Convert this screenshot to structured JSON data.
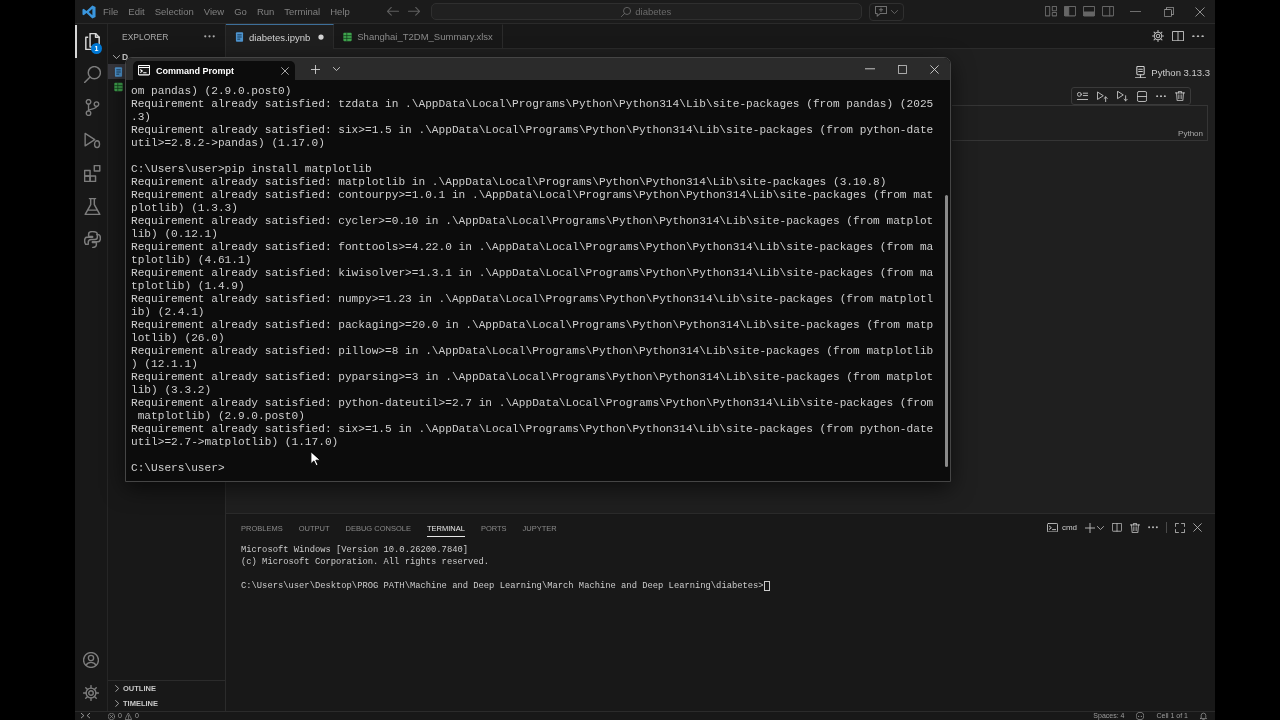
{
  "title_bar": {
    "menu": [
      "File",
      "Edit",
      "Selection",
      "View",
      "Go",
      "Run",
      "Terminal",
      "Help"
    ],
    "command_center": {
      "value": "diabetes"
    }
  },
  "activity_bar": {
    "top": [
      {
        "kind": "explorer",
        "selected": true,
        "badge": "1"
      },
      {
        "kind": "search",
        "selected": false
      },
      {
        "kind": "source-control",
        "selected": false
      },
      {
        "kind": "run-debug",
        "selected": false
      },
      {
        "kind": "extensions",
        "selected": false
      },
      {
        "kind": "testing",
        "selected": false
      },
      {
        "kind": "python",
        "selected": false
      }
    ],
    "bottom": [
      {
        "kind": "account"
      },
      {
        "kind": "settings"
      }
    ]
  },
  "sidebar": {
    "title": "EXPLORER",
    "folder": {
      "label": "D",
      "expanded": true,
      "files": [
        {
          "kind": "notebook",
          "selected": true
        },
        {
          "kind": "spreadsheet",
          "selected": false
        }
      ]
    },
    "sections": [
      {
        "label": "OUTLINE",
        "expanded": false
      },
      {
        "label": "TIMELINE",
        "expanded": false
      }
    ]
  },
  "editor_tabs": [
    {
      "label": "diabetes.ipynb",
      "kind": "notebook",
      "selected": true,
      "modified": true
    },
    {
      "label": "Shanghai_T2DM_Summary.xlsx",
      "kind": "spreadsheet",
      "selected": false,
      "modified": false
    }
  ],
  "notebook": {
    "kernel": "Python 3.13.3",
    "cell": {
      "language": "Python"
    }
  },
  "panel": {
    "tabs": [
      {
        "label": "PROBLEMS",
        "selected": false
      },
      {
        "label": "OUTPUT",
        "selected": false
      },
      {
        "label": "DEBUG CONSOLE",
        "selected": false
      },
      {
        "label": "TERMINAL",
        "selected": true
      },
      {
        "label": "PORTS",
        "selected": false
      },
      {
        "label": "JUPYTER",
        "selected": false
      }
    ],
    "shell": "cmd",
    "output": [
      [
        "Microsoft Windows [Version 10.0.26200.7840]",
        "(c) Microsoft Corporation. All rights reserved."
      ],
      [
        "C:\\Users\\user\\Desktop\\PROG PATH\\Machine and Deep Learning\\March Machine and Deep Learning\\diabetes>"
      ]
    ]
  },
  "status_bar": {
    "errors": "0",
    "warnings": "0",
    "items": [
      {
        "kind": "text",
        "label": "Spaces: 4"
      },
      {
        "kind": "copilot"
      },
      {
        "kind": "text",
        "label": "Cell 1 of 1"
      },
      {
        "kind": "bell"
      }
    ]
  },
  "command_prompt": {
    "tab": "Command Prompt",
    "output": [
      [
        "om pandas) (2.9.0.post0)",
        "Requirement already satisfied: tzdata in .\\AppData\\Local\\Programs\\Python\\Python314\\Lib\\site-packages (from pandas) (2025",
        ".3)",
        "Requirement already satisfied: six>=1.5 in .\\AppData\\Local\\Programs\\Python\\Python314\\Lib\\site-packages (from python-date",
        "util>=2.8.2->pandas) (1.17.0)"
      ],
      [
        "C:\\Users\\user>pip install matplotlib",
        "Requirement already satisfied: matplotlib in .\\AppData\\Local\\Programs\\Python\\Python314\\Lib\\site-packages (3.10.8)",
        "Requirement already satisfied: contourpy>=1.0.1 in .\\AppData\\Local\\Programs\\Python\\Python314\\Lib\\site-packages (from mat",
        "plotlib) (1.3.3)",
        "Requirement already satisfied: cycler>=0.10 in .\\AppData\\Local\\Programs\\Python\\Python314\\Lib\\site-packages (from matplot",
        "lib) (0.12.1)",
        "Requirement already satisfied: fonttools>=4.22.0 in .\\AppData\\Local\\Programs\\Python\\Python314\\Lib\\site-packages (from ma",
        "tplotlib) (4.61.1)",
        "Requirement already satisfied: kiwisolver>=1.3.1 in .\\AppData\\Local\\Programs\\Python\\Python314\\Lib\\site-packages (from ma",
        "tplotlib) (1.4.9)",
        "Requirement already satisfied: numpy>=1.23 in .\\AppData\\Local\\Programs\\Python\\Python314\\Lib\\site-packages (from matplotl",
        "ib) (2.4.1)",
        "Requirement already satisfied: packaging>=20.0 in .\\AppData\\Local\\Programs\\Python\\Python314\\Lib\\site-packages (from matp",
        "lotlib) (26.0)",
        "Requirement already satisfied: pillow>=8 in .\\AppData\\Local\\Programs\\Python\\Python314\\Lib\\site-packages (from matplotlib",
        ") (12.1.1)",
        "Requirement already satisfied: pyparsing>=3 in .\\AppData\\Local\\Programs\\Python\\Python314\\Lib\\site-packages (from matplot",
        "lib) (3.3.2)",
        "Requirement already satisfied: python-dateutil>=2.7 in .\\AppData\\Local\\Programs\\Python\\Python314\\Lib\\site-packages (from",
        " matplotlib) (2.9.0.post0)",
        "Requirement already satisfied: six>=1.5 in .\\AppData\\Local\\Programs\\Python\\Python314\\Lib\\site-packages (from python-date",
        "util>=2.7->matplotlib) (1.17.0)"
      ],
      [
        "C:\\Users\\user>"
      ]
    ]
  }
}
